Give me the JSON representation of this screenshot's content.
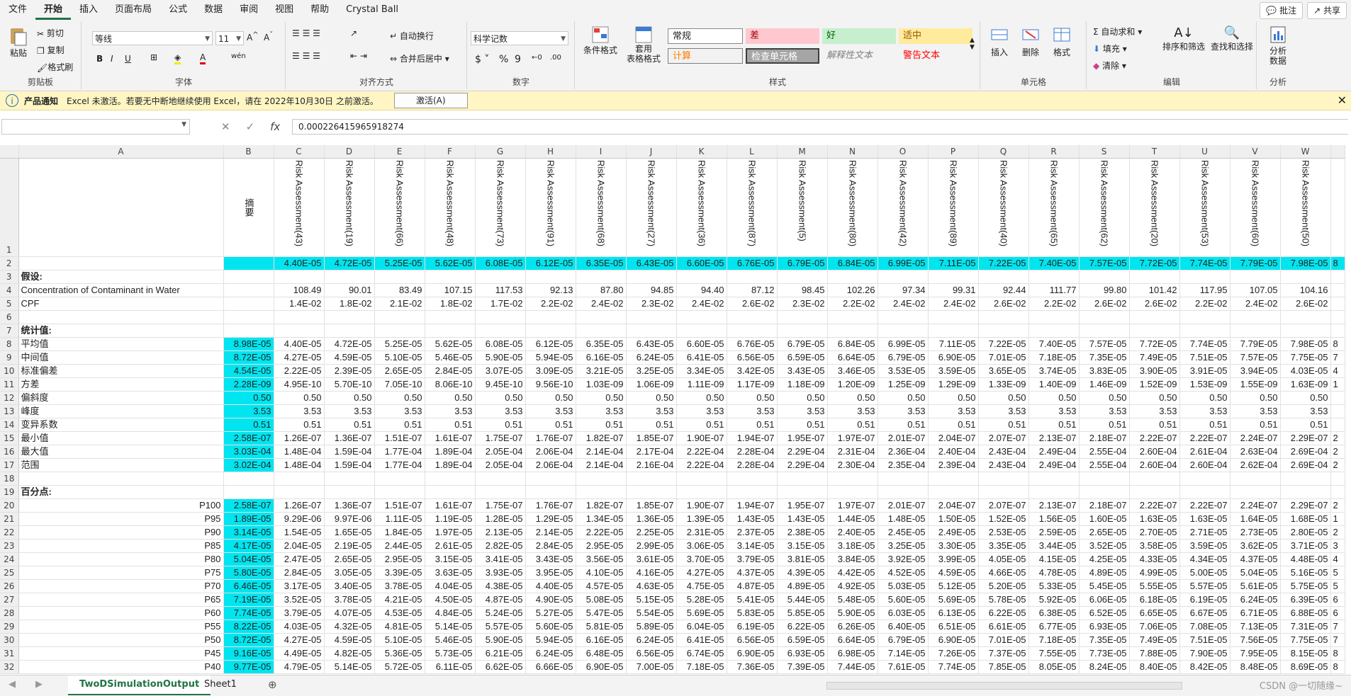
{
  "menu": {
    "items": [
      "文件",
      "开始",
      "插入",
      "页面布局",
      "公式",
      "数据",
      "审阅",
      "视图",
      "帮助",
      "Crystal Ball"
    ],
    "active": "开始",
    "comment_label": "批注",
    "share_label": "共享"
  },
  "ribbon": {
    "clipboard": {
      "paste": "粘贴",
      "cut": "剪切",
      "copy": "复制",
      "format_painter": "格式刷",
      "group": "剪贴板"
    },
    "font": {
      "font_name": "等线",
      "font_size": "11",
      "group": "字体"
    },
    "alignment": {
      "wrap": "自动换行",
      "merge": "合并后居中",
      "group": "对齐方式"
    },
    "number": {
      "format": "科学记数",
      "group": "数字"
    },
    "styles": {
      "conditional": "条件格式",
      "table_format": "套用\n表格格式",
      "normal": "常规",
      "bad": "差",
      "good": "好",
      "neutral": "适中",
      "calc": "计算",
      "check": "检查单元格",
      "explain": "解释性文本",
      "warn": "警告文本",
      "group": "样式"
    },
    "cells": {
      "insert": "插入",
      "delete": "删除",
      "format": "格式",
      "group": "单元格"
    },
    "editing": {
      "autosum": "自动求和",
      "fill": "填充",
      "clear": "清除",
      "sort": "排序和筛选",
      "find": "查找和选择",
      "group": "编辑"
    },
    "analysis": {
      "analyze": "分析\n数据",
      "group": "分析"
    }
  },
  "notification": {
    "title": "产品通知",
    "message": "Excel 未激活。若要无中断地继续使用 Excel，请在 2022年10月30日 之前激活。",
    "button": "激活(A)"
  },
  "formula_bar": {
    "name_box": "",
    "value": "0.000226415965918274"
  },
  "grid": {
    "columns": [
      "A",
      "B",
      "C",
      "D",
      "E",
      "F",
      "G",
      "H",
      "I",
      "J",
      "K",
      "L",
      "M",
      "N",
      "O",
      "P",
      "Q",
      "R",
      "S",
      "T",
      "U",
      "V",
      "W"
    ],
    "b1_header": "摘要",
    "vertical_headers": [
      "Risk Assessment(43)",
      "Risk Assessment(19)",
      "Risk Assessment(66)",
      "Risk Assessment(48)",
      "Risk Assessment(73)",
      "Risk Assessment(91)",
      "Risk Assessment(68)",
      "Risk Assessment(27)",
      "Risk Assessment(36)",
      "Risk Assessment(87)",
      "Risk Assessment(5)",
      "Risk Assessment(80)",
      "Risk Assessment(42)",
      "Risk Assessment(89)",
      "Risk Assessment(40)",
      "Risk Assessment(65)",
      "Risk Assessment(62)",
      "Risk Assessment(20)",
      "Risk Assessment(53)",
      "Risk Assessment(60)",
      "Risk Assessment(50)"
    ],
    "rows": [
      {
        "n": "2",
        "a": "",
        "b": "",
        "cyan_all": true,
        "vals": [
          "4.40E-05",
          "4.72E-05",
          "5.25E-05",
          "5.62E-05",
          "6.08E-05",
          "6.12E-05",
          "6.35E-05",
          "6.43E-05",
          "6.60E-05",
          "6.76E-05",
          "6.79E-05",
          "6.84E-05",
          "6.99E-05",
          "7.11E-05",
          "7.22E-05",
          "7.40E-05",
          "7.57E-05",
          "7.72E-05",
          "7.74E-05",
          "7.79E-05",
          "7.98E-05"
        ],
        "extra": "8"
      },
      {
        "n": "3",
        "a": "假设:",
        "bold": true,
        "b": "",
        "vals": [],
        "extra": ""
      },
      {
        "n": "4",
        "a": "Concentration of Contaminant in Water",
        "b": "",
        "vals": [
          "108.49",
          "90.01",
          "83.49",
          "107.15",
          "117.53",
          "92.13",
          "87.80",
          "94.85",
          "94.40",
          "87.12",
          "98.45",
          "102.26",
          "97.34",
          "99.31",
          "92.44",
          "111.77",
          "99.80",
          "101.42",
          "117.95",
          "107.05",
          "104.16"
        ],
        "extra": ""
      },
      {
        "n": "5",
        "a": "CPF",
        "b": "",
        "vals": [
          "1.4E-02",
          "1.8E-02",
          "2.1E-02",
          "1.8E-02",
          "1.7E-02",
          "2.2E-02",
          "2.4E-02",
          "2.3E-02",
          "2.4E-02",
          "2.6E-02",
          "2.3E-02",
          "2.2E-02",
          "2.4E-02",
          "2.4E-02",
          "2.6E-02",
          "2.2E-02",
          "2.6E-02",
          "2.6E-02",
          "2.2E-02",
          "2.4E-02",
          "2.6E-02"
        ],
        "extra": ""
      },
      {
        "n": "6",
        "a": "",
        "b": "",
        "vals": [],
        "extra": ""
      },
      {
        "n": "7",
        "a": "统计值:",
        "bold": true,
        "b": "",
        "vals": [],
        "extra": ""
      },
      {
        "n": "8",
        "a": "平均值",
        "b": "8.98E-05",
        "vals": [
          "4.40E-05",
          "4.72E-05",
          "5.25E-05",
          "5.62E-05",
          "6.08E-05",
          "6.12E-05",
          "6.35E-05",
          "6.43E-05",
          "6.60E-05",
          "6.76E-05",
          "6.79E-05",
          "6.84E-05",
          "6.99E-05",
          "7.11E-05",
          "7.22E-05",
          "7.40E-05",
          "7.57E-05",
          "7.72E-05",
          "7.74E-05",
          "7.79E-05",
          "7.98E-05"
        ],
        "extra": "8"
      },
      {
        "n": "9",
        "a": "中间值",
        "b": "8.72E-05",
        "vals": [
          "4.27E-05",
          "4.59E-05",
          "5.10E-05",
          "5.46E-05",
          "5.90E-05",
          "5.94E-05",
          "6.16E-05",
          "6.24E-05",
          "6.41E-05",
          "6.56E-05",
          "6.59E-05",
          "6.64E-05",
          "6.79E-05",
          "6.90E-05",
          "7.01E-05",
          "7.18E-05",
          "7.35E-05",
          "7.49E-05",
          "7.51E-05",
          "7.57E-05",
          "7.75E-05"
        ],
        "extra": "7"
      },
      {
        "n": "10",
        "a": "标准偏差",
        "b": "4.54E-05",
        "vals": [
          "2.22E-05",
          "2.39E-05",
          "2.65E-05",
          "2.84E-05",
          "3.07E-05",
          "3.09E-05",
          "3.21E-05",
          "3.25E-05",
          "3.34E-05",
          "3.42E-05",
          "3.43E-05",
          "3.46E-05",
          "3.53E-05",
          "3.59E-05",
          "3.65E-05",
          "3.74E-05",
          "3.83E-05",
          "3.90E-05",
          "3.91E-05",
          "3.94E-05",
          "4.03E-05"
        ],
        "extra": "4"
      },
      {
        "n": "11",
        "a": "方差",
        "b": "2.28E-09",
        "vals": [
          "4.95E-10",
          "5.70E-10",
          "7.05E-10",
          "8.06E-10",
          "9.45E-10",
          "9.56E-10",
          "1.03E-09",
          "1.06E-09",
          "1.11E-09",
          "1.17E-09",
          "1.18E-09",
          "1.20E-09",
          "1.25E-09",
          "1.29E-09",
          "1.33E-09",
          "1.40E-09",
          "1.46E-09",
          "1.52E-09",
          "1.53E-09",
          "1.55E-09",
          "1.63E-09"
        ],
        "extra": "1"
      },
      {
        "n": "12",
        "a": "偏斜度",
        "b": "0.50",
        "vals": [
          "0.50",
          "0.50",
          "0.50",
          "0.50",
          "0.50",
          "0.50",
          "0.50",
          "0.50",
          "0.50",
          "0.50",
          "0.50",
          "0.50",
          "0.50",
          "0.50",
          "0.50",
          "0.50",
          "0.50",
          "0.50",
          "0.50",
          "0.50",
          "0.50"
        ],
        "extra": ""
      },
      {
        "n": "13",
        "a": "峰度",
        "b": "3.53",
        "vals": [
          "3.53",
          "3.53",
          "3.53",
          "3.53",
          "3.53",
          "3.53",
          "3.53",
          "3.53",
          "3.53",
          "3.53",
          "3.53",
          "3.53",
          "3.53",
          "3.53",
          "3.53",
          "3.53",
          "3.53",
          "3.53",
          "3.53",
          "3.53",
          "3.53"
        ],
        "extra": ""
      },
      {
        "n": "14",
        "a": "变异系数",
        "b": "0.51",
        "vals": [
          "0.51",
          "0.51",
          "0.51",
          "0.51",
          "0.51",
          "0.51",
          "0.51",
          "0.51",
          "0.51",
          "0.51",
          "0.51",
          "0.51",
          "0.51",
          "0.51",
          "0.51",
          "0.51",
          "0.51",
          "0.51",
          "0.51",
          "0.51",
          "0.51"
        ],
        "extra": ""
      },
      {
        "n": "15",
        "a": "最小值",
        "b": "2.58E-07",
        "vals": [
          "1.26E-07",
          "1.36E-07",
          "1.51E-07",
          "1.61E-07",
          "1.75E-07",
          "1.76E-07",
          "1.82E-07",
          "1.85E-07",
          "1.90E-07",
          "1.94E-07",
          "1.95E-07",
          "1.97E-07",
          "2.01E-07",
          "2.04E-07",
          "2.07E-07",
          "2.13E-07",
          "2.18E-07",
          "2.22E-07",
          "2.22E-07",
          "2.24E-07",
          "2.29E-07"
        ],
        "extra": "2"
      },
      {
        "n": "16",
        "a": "最大值",
        "b": "3.03E-04",
        "vals": [
          "1.48E-04",
          "1.59E-04",
          "1.77E-04",
          "1.89E-04",
          "2.05E-04",
          "2.06E-04",
          "2.14E-04",
          "2.17E-04",
          "2.22E-04",
          "2.28E-04",
          "2.29E-04",
          "2.31E-04",
          "2.36E-04",
          "2.40E-04",
          "2.43E-04",
          "2.49E-04",
          "2.55E-04",
          "2.60E-04",
          "2.61E-04",
          "2.63E-04",
          "2.69E-04"
        ],
        "extra": "2"
      },
      {
        "n": "17",
        "a": "范围",
        "b": "3.02E-04",
        "vals": [
          "1.48E-04",
          "1.59E-04",
          "1.77E-04",
          "1.89E-04",
          "2.05E-04",
          "2.06E-04",
          "2.14E-04",
          "2.16E-04",
          "2.22E-04",
          "2.28E-04",
          "2.29E-04",
          "2.30E-04",
          "2.35E-04",
          "2.39E-04",
          "2.43E-04",
          "2.49E-04",
          "2.55E-04",
          "2.60E-04",
          "2.60E-04",
          "2.62E-04",
          "2.69E-04"
        ],
        "extra": "2"
      },
      {
        "n": "18",
        "a": "",
        "b": "",
        "vals": [],
        "extra": ""
      },
      {
        "n": "19",
        "a": "百分点:",
        "bold": true,
        "b": "",
        "vals": [],
        "extra": ""
      },
      {
        "n": "20",
        "a": "P100",
        "right": true,
        "b": "2.58E-07",
        "vals": [
          "1.26E-07",
          "1.36E-07",
          "1.51E-07",
          "1.61E-07",
          "1.75E-07",
          "1.76E-07",
          "1.82E-07",
          "1.85E-07",
          "1.90E-07",
          "1.94E-07",
          "1.95E-07",
          "1.97E-07",
          "2.01E-07",
          "2.04E-07",
          "2.07E-07",
          "2.13E-07",
          "2.18E-07",
          "2.22E-07",
          "2.22E-07",
          "2.24E-07",
          "2.29E-07"
        ],
        "extra": "2"
      },
      {
        "n": "21",
        "a": "P95",
        "right": true,
        "b": "1.89E-05",
        "vals": [
          "9.29E-06",
          "9.97E-06",
          "1.11E-05",
          "1.19E-05",
          "1.28E-05",
          "1.29E-05",
          "1.34E-05",
          "1.36E-05",
          "1.39E-05",
          "1.43E-05",
          "1.43E-05",
          "1.44E-05",
          "1.48E-05",
          "1.50E-05",
          "1.52E-05",
          "1.56E-05",
          "1.60E-05",
          "1.63E-05",
          "1.63E-05",
          "1.64E-05",
          "1.68E-05"
        ],
        "extra": "1"
      },
      {
        "n": "22",
        "a": "P90",
        "right": true,
        "b": "3.14E-05",
        "vals": [
          "1.54E-05",
          "1.65E-05",
          "1.84E-05",
          "1.97E-05",
          "2.13E-05",
          "2.14E-05",
          "2.22E-05",
          "2.25E-05",
          "2.31E-05",
          "2.37E-05",
          "2.38E-05",
          "2.40E-05",
          "2.45E-05",
          "2.49E-05",
          "2.53E-05",
          "2.59E-05",
          "2.65E-05",
          "2.70E-05",
          "2.71E-05",
          "2.73E-05",
          "2.80E-05"
        ],
        "extra": "2"
      },
      {
        "n": "23",
        "a": "P85",
        "right": true,
        "b": "4.17E-05",
        "vals": [
          "2.04E-05",
          "2.19E-05",
          "2.44E-05",
          "2.61E-05",
          "2.82E-05",
          "2.84E-05",
          "2.95E-05",
          "2.99E-05",
          "3.06E-05",
          "3.14E-05",
          "3.15E-05",
          "3.18E-05",
          "3.25E-05",
          "3.30E-05",
          "3.35E-05",
          "3.44E-05",
          "3.52E-05",
          "3.58E-05",
          "3.59E-05",
          "3.62E-05",
          "3.71E-05"
        ],
        "extra": "3"
      },
      {
        "n": "24",
        "a": "P80",
        "right": true,
        "b": "5.04E-05",
        "vals": [
          "2.47E-05",
          "2.65E-05",
          "2.95E-05",
          "3.15E-05",
          "3.41E-05",
          "3.43E-05",
          "3.56E-05",
          "3.61E-05",
          "3.70E-05",
          "3.79E-05",
          "3.81E-05",
          "3.84E-05",
          "3.92E-05",
          "3.99E-05",
          "4.05E-05",
          "4.15E-05",
          "4.25E-05",
          "4.33E-05",
          "4.34E-05",
          "4.37E-05",
          "4.48E-05"
        ],
        "extra": "4"
      },
      {
        "n": "25",
        "a": "P75",
        "right": true,
        "b": "5.80E-05",
        "vals": [
          "2.84E-05",
          "3.05E-05",
          "3.39E-05",
          "3.63E-05",
          "3.93E-05",
          "3.95E-05",
          "4.10E-05",
          "4.16E-05",
          "4.27E-05",
          "4.37E-05",
          "4.39E-05",
          "4.42E-05",
          "4.52E-05",
          "4.59E-05",
          "4.66E-05",
          "4.78E-05",
          "4.89E-05",
          "4.99E-05",
          "5.00E-05",
          "5.04E-05",
          "5.16E-05"
        ],
        "extra": "5"
      },
      {
        "n": "26",
        "a": "P70",
        "right": true,
        "b": "6.46E-05",
        "vals": [
          "3.17E-05",
          "3.40E-05",
          "3.78E-05",
          "4.04E-05",
          "4.38E-05",
          "4.40E-05",
          "4.57E-05",
          "4.63E-05",
          "4.75E-05",
          "4.87E-05",
          "4.89E-05",
          "4.92E-05",
          "5.03E-05",
          "5.12E-05",
          "5.20E-05",
          "5.33E-05",
          "5.45E-05",
          "5.55E-05",
          "5.57E-05",
          "5.61E-05",
          "5.75E-05"
        ],
        "extra": "5"
      },
      {
        "n": "27",
        "a": "P65",
        "right": true,
        "b": "7.19E-05",
        "vals": [
          "3.52E-05",
          "3.78E-05",
          "4.21E-05",
          "4.50E-05",
          "4.87E-05",
          "4.90E-05",
          "5.08E-05",
          "5.15E-05",
          "5.28E-05",
          "5.41E-05",
          "5.44E-05",
          "5.48E-05",
          "5.60E-05",
          "5.69E-05",
          "5.78E-05",
          "5.92E-05",
          "6.06E-05",
          "6.18E-05",
          "6.19E-05",
          "6.24E-05",
          "6.39E-05"
        ],
        "extra": "6"
      },
      {
        "n": "28",
        "a": "P60",
        "right": true,
        "b": "7.74E-05",
        "vals": [
          "3.79E-05",
          "4.07E-05",
          "4.53E-05",
          "4.84E-05",
          "5.24E-05",
          "5.27E-05",
          "5.47E-05",
          "5.54E-05",
          "5.69E-05",
          "5.83E-05",
          "5.85E-05",
          "5.90E-05",
          "6.03E-05",
          "6.13E-05",
          "6.22E-05",
          "6.38E-05",
          "6.52E-05",
          "6.65E-05",
          "6.67E-05",
          "6.71E-05",
          "6.88E-05"
        ],
        "extra": "6"
      },
      {
        "n": "29",
        "a": "P55",
        "right": true,
        "b": "8.22E-05",
        "vals": [
          "4.03E-05",
          "4.32E-05",
          "4.81E-05",
          "5.14E-05",
          "5.57E-05",
          "5.60E-05",
          "5.81E-05",
          "5.89E-05",
          "6.04E-05",
          "6.19E-05",
          "6.22E-05",
          "6.26E-05",
          "6.40E-05",
          "6.51E-05",
          "6.61E-05",
          "6.77E-05",
          "6.93E-05",
          "7.06E-05",
          "7.08E-05",
          "7.13E-05",
          "7.31E-05"
        ],
        "extra": "7"
      },
      {
        "n": "30",
        "a": "P50",
        "right": true,
        "b": "8.72E-05",
        "vals": [
          "4.27E-05",
          "4.59E-05",
          "5.10E-05",
          "5.46E-05",
          "5.90E-05",
          "5.94E-05",
          "6.16E-05",
          "6.24E-05",
          "6.41E-05",
          "6.56E-05",
          "6.59E-05",
          "6.64E-05",
          "6.79E-05",
          "6.90E-05",
          "7.01E-05",
          "7.18E-05",
          "7.35E-05",
          "7.49E-05",
          "7.51E-05",
          "7.56E-05",
          "7.75E-05"
        ],
        "extra": "7"
      },
      {
        "n": "31",
        "a": "P45",
        "right": true,
        "b": "9.16E-05",
        "vals": [
          "4.49E-05",
          "4.82E-05",
          "5.36E-05",
          "5.73E-05",
          "6.21E-05",
          "6.24E-05",
          "6.48E-05",
          "6.56E-05",
          "6.74E-05",
          "6.90E-05",
          "6.93E-05",
          "6.98E-05",
          "7.14E-05",
          "7.26E-05",
          "7.37E-05",
          "7.55E-05",
          "7.73E-05",
          "7.88E-05",
          "7.90E-05",
          "7.95E-05",
          "8.15E-05"
        ],
        "extra": "8"
      },
      {
        "n": "32",
        "a": "P40",
        "right": true,
        "b": "9.77E-05",
        "vals": [
          "4.79E-05",
          "5.14E-05",
          "5.72E-05",
          "6.11E-05",
          "6.62E-05",
          "6.66E-05",
          "6.90E-05",
          "7.00E-05",
          "7.18E-05",
          "7.36E-05",
          "7.39E-05",
          "7.44E-05",
          "7.61E-05",
          "7.74E-05",
          "7.85E-05",
          "8.05E-05",
          "8.24E-05",
          "8.40E-05",
          "8.42E-05",
          "8.48E-05",
          "8.69E-05"
        ],
        "extra": "8"
      }
    ]
  },
  "tabs": {
    "items": [
      "TwoDSimulationOutput",
      "Sheet1"
    ],
    "active": "TwoDSimulationOutput"
  },
  "watermark": "CSDN @一切随缘~"
}
